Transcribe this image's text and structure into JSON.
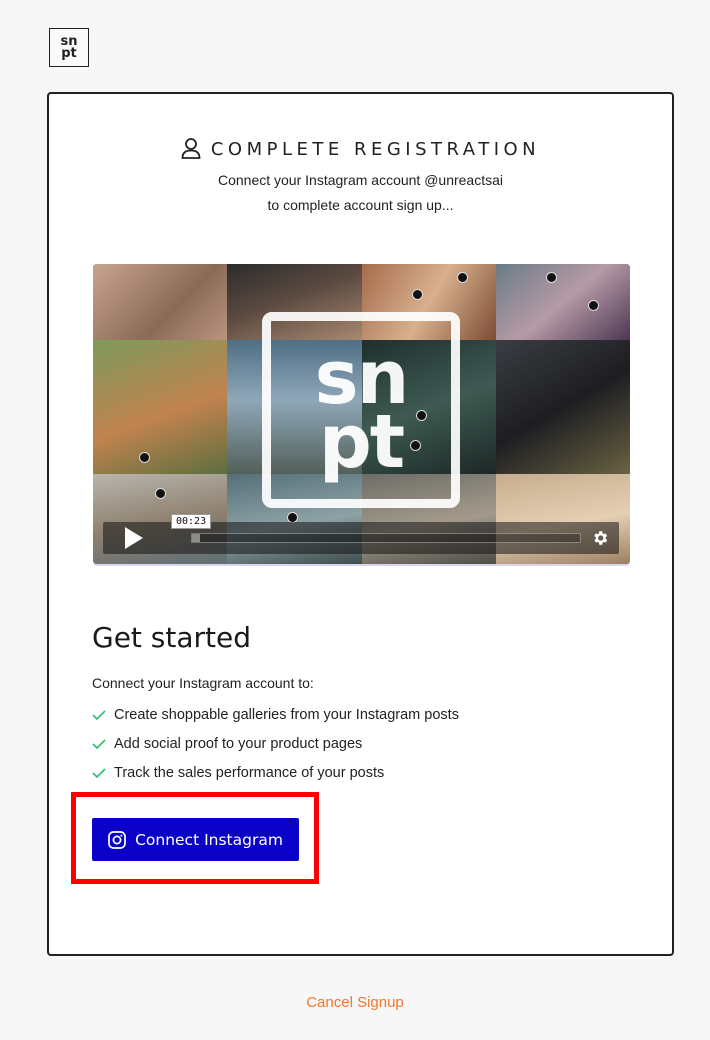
{
  "brand": {
    "logo_top": "sn",
    "logo_bottom": "pt"
  },
  "registration": {
    "title": "COMPLETE REGISTRATION",
    "subtitle_line1": "Connect your Instagram account @unreactsai",
    "subtitle_line2": "to complete account sign up..."
  },
  "video": {
    "watermark_top": "sn",
    "watermark_bottom": "pt",
    "timestamp": "00:23",
    "progress_fraction": 0.02
  },
  "get_started": {
    "heading": "Get started",
    "intro": "Connect your Instagram account to:",
    "benefits": [
      "Create shoppable galleries from your Instagram posts",
      "Add social proof to your product pages",
      "Track the sales performance of your posts"
    ],
    "connect_label": "Connect Instagram"
  },
  "footer": {
    "cancel_label": "Cancel Signup"
  },
  "colors": {
    "primary_button": "#0a00c8",
    "cancel_link": "#f4762b",
    "check": "#2bbf6a",
    "highlight": "#ff0000"
  },
  "icons": [
    "user-icon",
    "play-icon",
    "gear-icon",
    "check-icon",
    "instagram-icon"
  ]
}
